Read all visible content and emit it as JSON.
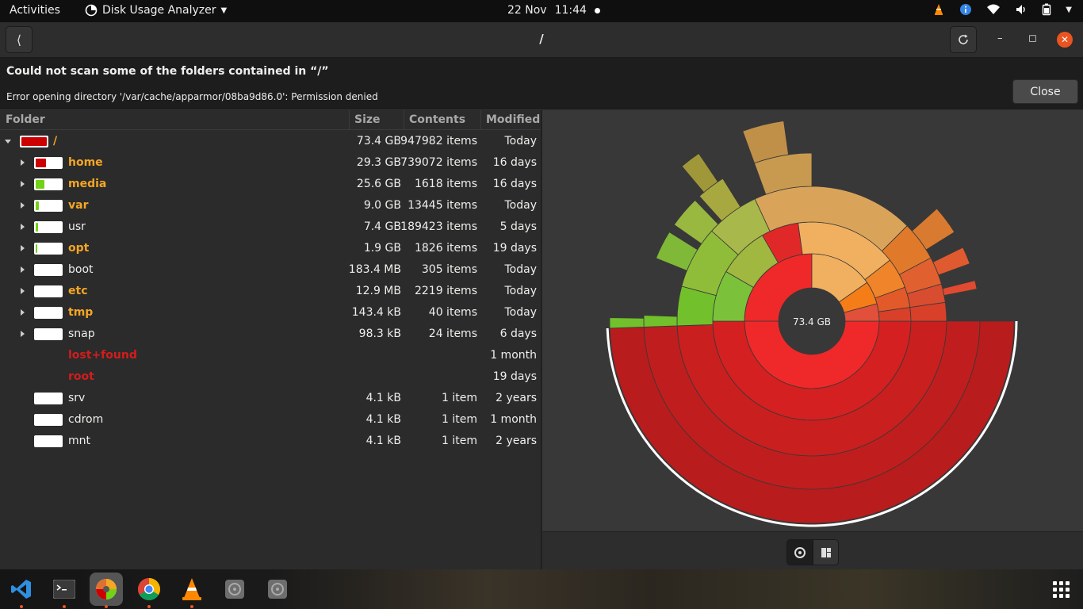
{
  "topbar": {
    "activities": "Activities",
    "app_name": "Disk Usage Analyzer",
    "date": "22 Nov",
    "time": "11:44"
  },
  "header": {
    "title": "/"
  },
  "infobar": {
    "title": "Could not scan some of the folders contained in “/”",
    "detail": "Error opening directory '/var/cache/apparmor/08ba9d86.0': Permission denied",
    "close_label": "Close"
  },
  "columns": {
    "folder": "Folder",
    "size": "Size",
    "contents": "Contents",
    "modified": "Modified"
  },
  "rows": [
    {
      "name": "/",
      "size": "73.4 GB",
      "contents": "947982 items",
      "modified": "Today",
      "usage_fraction": 1.0,
      "fill_color": "#cc0000",
      "name_color": "#f5a623"
    },
    {
      "name": "home",
      "size": "29.3 GB",
      "contents": "739072 items",
      "modified": "16 days",
      "usage_fraction": 0.4,
      "fill_color": "#cc0000",
      "name_color": "#f5a623"
    },
    {
      "name": "media",
      "size": "25.6 GB",
      "contents": "1618 items",
      "modified": "16 days",
      "usage_fraction": 0.35,
      "fill_color": "#73d216",
      "name_color": "#f5a623"
    },
    {
      "name": "var",
      "size": "9.0 GB",
      "contents": "13445 items",
      "modified": "Today",
      "usage_fraction": 0.12,
      "fill_color": "#73d216",
      "name_color": "#f5a623"
    },
    {
      "name": "usr",
      "size": "7.4 GB",
      "contents": "189423 items",
      "modified": "5 days",
      "usage_fraction": 0.1,
      "fill_color": "#73d216",
      "name_color": "#eeeeec"
    },
    {
      "name": "opt",
      "size": "1.9 GB",
      "contents": "1826 items",
      "modified": "19 days",
      "usage_fraction": 0.03,
      "fill_color": "#73d216",
      "name_color": "#f5a623"
    },
    {
      "name": "boot",
      "size": "183.4 MB",
      "contents": "305 items",
      "modified": "Today",
      "usage_fraction": 0.0,
      "fill_color": "#73d216",
      "name_color": "#eeeeec"
    },
    {
      "name": "etc",
      "size": "12.9 MB",
      "contents": "2219 items",
      "modified": "Today",
      "usage_fraction": 0.0,
      "fill_color": "#73d216",
      "name_color": "#f5a623"
    },
    {
      "name": "tmp",
      "size": "143.4 kB",
      "contents": "40 items",
      "modified": "Today",
      "usage_fraction": 0.0,
      "fill_color": "#73d216",
      "name_color": "#f5a623"
    },
    {
      "name": "snap",
      "size": "98.3 kB",
      "contents": "24 items",
      "modified": "6 days",
      "usage_fraction": 0.0,
      "fill_color": "#73d216",
      "name_color": "#eeeeec"
    },
    {
      "name": "lost+found",
      "size": "",
      "contents": "",
      "modified": "1 month",
      "usage_fraction": null,
      "fill_color": "",
      "name_color": "#d41c1c"
    },
    {
      "name": "root",
      "size": "",
      "contents": "",
      "modified": "19 days",
      "usage_fraction": null,
      "fill_color": "",
      "name_color": "#d41c1c"
    },
    {
      "name": "srv",
      "size": "4.1 kB",
      "contents": "1 item",
      "modified": "2 years",
      "usage_fraction": 0.0,
      "fill_color": "#73d216",
      "name_color": "#eeeeec"
    },
    {
      "name": "cdrom",
      "size": "4.1 kB",
      "contents": "1 item",
      "modified": "1 month",
      "usage_fraction": 0.0,
      "fill_color": "#73d216",
      "name_color": "#eeeeec"
    },
    {
      "name": "mnt",
      "size": "4.1 kB",
      "contents": "1 item",
      "modified": "2 years",
      "usage_fraction": 0.0,
      "fill_color": "#73d216",
      "name_color": "#eeeeec"
    }
  ],
  "chart": {
    "center_label": "73.4 GB"
  },
  "chart_data": {
    "type": "sunburst",
    "title": "",
    "total": "73.4 GB",
    "segments": [
      {
        "label": "home",
        "value": 29.3,
        "color": "#cc0000"
      },
      {
        "label": "media",
        "value": 25.6,
        "color": "#f0a050"
      },
      {
        "label": "var",
        "value": 9.0,
        "color": "#8ab43a"
      },
      {
        "label": "usr",
        "value": 7.4,
        "color": "#73c030"
      },
      {
        "label": "opt",
        "value": 1.9,
        "color": "#e07030"
      }
    ]
  },
  "dock": {
    "apps": [
      "vscode-icon",
      "terminal-icon",
      "disk-usage-icon",
      "chrome-icon",
      "vlc-icon",
      "disk-icon",
      "disk-icon"
    ]
  }
}
